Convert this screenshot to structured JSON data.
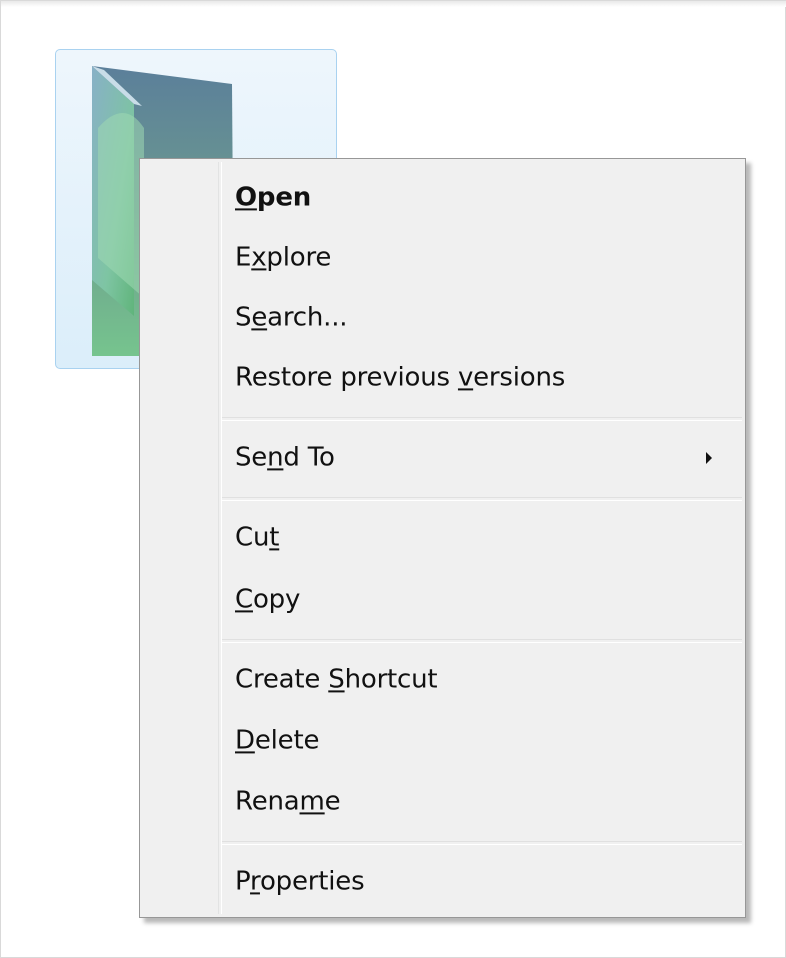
{
  "menu": {
    "items": [
      {
        "pre": "",
        "key": "O",
        "post": "pen",
        "bold": true
      },
      {
        "pre": "E",
        "key": "x",
        "post": "plore"
      },
      {
        "pre": "S",
        "key": "e",
        "post": "arch..."
      },
      {
        "pre": "Restore previous ",
        "key": "v",
        "post": "ersions"
      },
      {
        "pre": "Se",
        "key": "n",
        "post": "d To",
        "submenu": true
      },
      {
        "pre": "Cu",
        "key": "t",
        "post": ""
      },
      {
        "pre": "",
        "key": "C",
        "post": "opy"
      },
      {
        "pre": "Create ",
        "key": "S",
        "post": "hortcut"
      },
      {
        "pre": "",
        "key": "D",
        "post": "elete"
      },
      {
        "pre": "Rena",
        "key": "m",
        "post": "e"
      },
      {
        "pre": "P",
        "key": "r",
        "post": "operties"
      }
    ]
  },
  "colors": {
    "menu_background": "#f0f0f0",
    "menu_border": "#979797",
    "selection_border": "#a9d2f0",
    "selection_fill": "#dbeefa"
  },
  "icons": {
    "folder": "folder-icon",
    "submenu": "submenu-arrow-icon"
  }
}
